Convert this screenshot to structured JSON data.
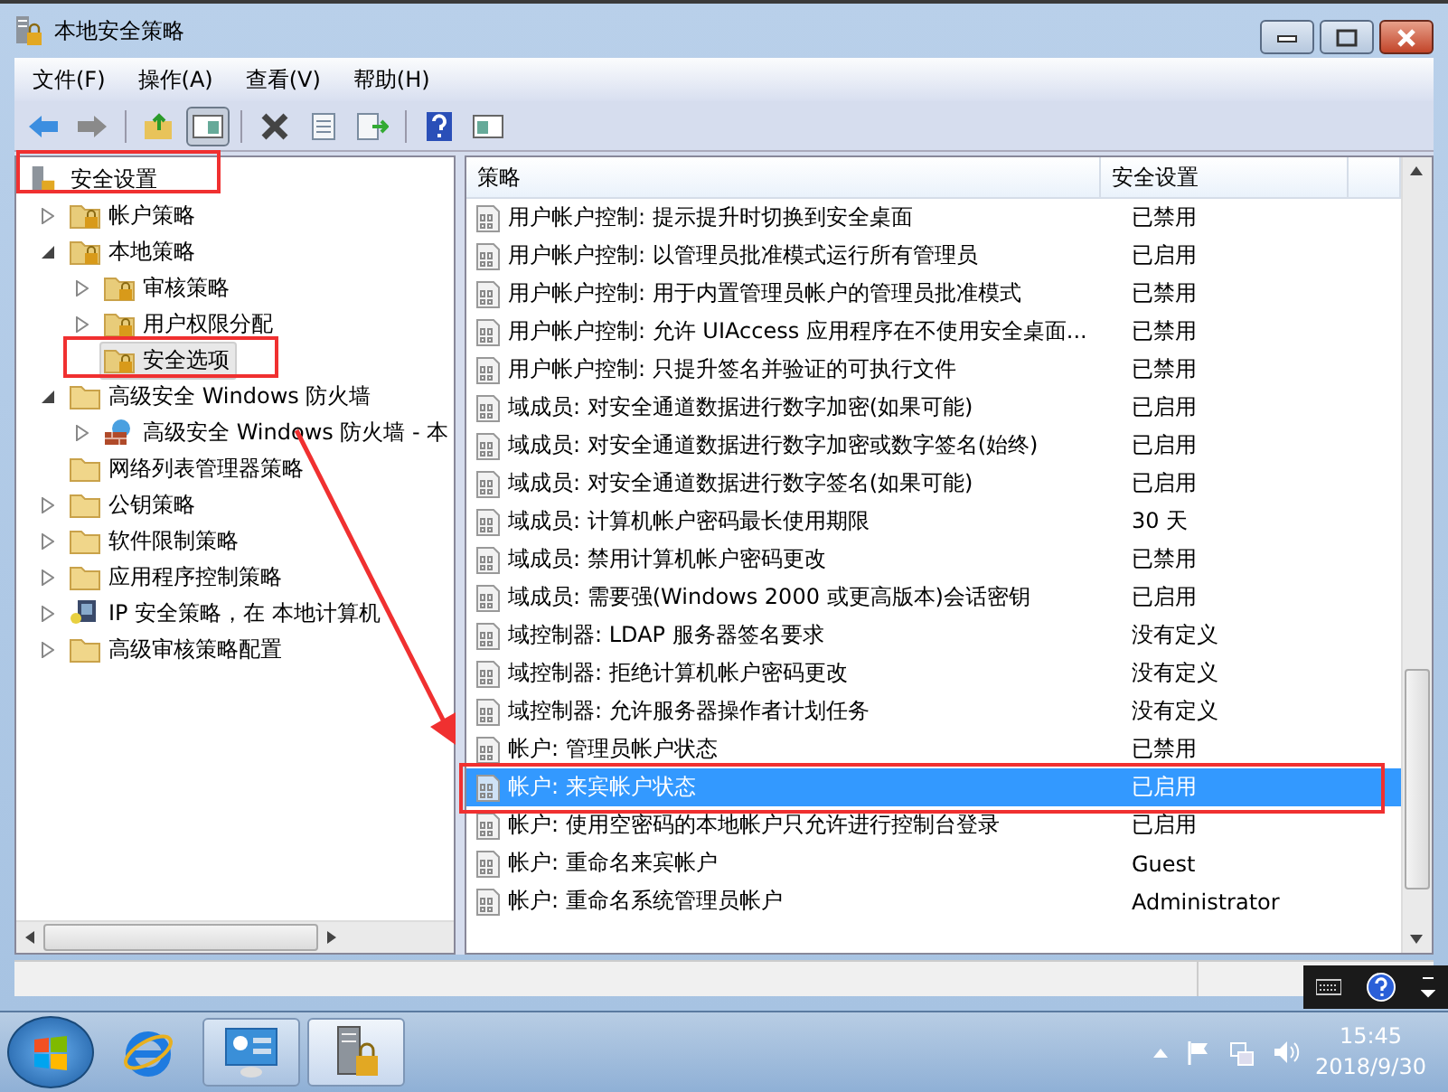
{
  "window": {
    "title": "本地安全策略"
  },
  "menu": [
    "文件(F)",
    "操作(A)",
    "查看(V)",
    "帮助(H)"
  ],
  "tree": {
    "label": "安全设置",
    "selected": false,
    "children": [
      {
        "label": "帐户策略",
        "kind": "lockfolder",
        "expanded": false,
        "selected": false
      },
      {
        "label": "本地策略",
        "kind": "lockfolder",
        "expanded": true,
        "selected": false,
        "children": [
          {
            "label": "审核策略",
            "kind": "lockfolder",
            "expanded": false,
            "selected": false
          },
          {
            "label": "用户权限分配",
            "kind": "lockfolder",
            "expanded": false,
            "selected": false
          },
          {
            "label": "安全选项",
            "kind": "lockfolder",
            "selected": true
          }
        ]
      },
      {
        "label": "高级安全 Windows 防火墙",
        "kind": "folder",
        "expanded": true,
        "selected": false,
        "children": [
          {
            "label": "高级安全 Windows 防火墙 - 本",
            "kind": "firewall",
            "expanded": false,
            "selected": false
          }
        ]
      },
      {
        "label": "网络列表管理器策略",
        "kind": "folder",
        "selected": false
      },
      {
        "label": "公钥策略",
        "kind": "folder",
        "expanded": false,
        "selected": false
      },
      {
        "label": "软件限制策略",
        "kind": "folder",
        "expanded": false,
        "selected": false
      },
      {
        "label": "应用程序控制策略",
        "kind": "folder",
        "expanded": false,
        "selected": false
      },
      {
        "label": "IP 安全策略，在 本地计算机",
        "kind": "ipsec",
        "expanded": false,
        "selected": false
      },
      {
        "label": "高级审核策略配置",
        "kind": "folder",
        "expanded": false,
        "selected": false
      }
    ]
  },
  "table": {
    "columns": [
      "策略",
      "安全设置"
    ],
    "rows": [
      {
        "policy": "用户帐户控制: 提示提升时切换到安全桌面",
        "setting": "已禁用",
        "selected": false
      },
      {
        "policy": "用户帐户控制: 以管理员批准模式运行所有管理员",
        "setting": "已启用",
        "selected": false
      },
      {
        "policy": "用户帐户控制: 用于内置管理员帐户的管理员批准模式",
        "setting": "已禁用",
        "selected": false
      },
      {
        "policy": "用户帐户控制: 允许 UIAccess 应用程序在不使用安全桌面...",
        "setting": "已禁用",
        "selected": false
      },
      {
        "policy": "用户帐户控制: 只提升签名并验证的可执行文件",
        "setting": "已禁用",
        "selected": false
      },
      {
        "policy": "域成员: 对安全通道数据进行数字加密(如果可能)",
        "setting": "已启用",
        "selected": false
      },
      {
        "policy": "域成员: 对安全通道数据进行数字加密或数字签名(始终)",
        "setting": "已启用",
        "selected": false
      },
      {
        "policy": "域成员: 对安全通道数据进行数字签名(如果可能)",
        "setting": "已启用",
        "selected": false
      },
      {
        "policy": "域成员: 计算机帐户密码最长使用期限",
        "setting": "30 天",
        "selected": false
      },
      {
        "policy": "域成员: 禁用计算机帐户密码更改",
        "setting": "已禁用",
        "selected": false
      },
      {
        "policy": "域成员: 需要强(Windows 2000 或更高版本)会话密钥",
        "setting": "已启用",
        "selected": false
      },
      {
        "policy": "域控制器: LDAP 服务器签名要求",
        "setting": "没有定义",
        "selected": false
      },
      {
        "policy": "域控制器: 拒绝计算机帐户密码更改",
        "setting": "没有定义",
        "selected": false
      },
      {
        "policy": "域控制器: 允许服务器操作者计划任务",
        "setting": "没有定义",
        "selected": false
      },
      {
        "policy": "帐户: 管理员帐户状态",
        "setting": "已禁用",
        "selected": false
      },
      {
        "policy": "帐户: 来宾帐户状态",
        "setting": "已启用",
        "selected": true
      },
      {
        "policy": "帐户: 使用空密码的本地帐户只允许进行控制台登录",
        "setting": "已启用",
        "selected": false
      },
      {
        "policy": "帐户: 重命名来宾帐户",
        "setting": "Guest",
        "selected": false
      },
      {
        "policy": "帐户: 重命名系统管理员帐户",
        "setting": "Administrator",
        "selected": false
      }
    ]
  },
  "clock": {
    "time": "15:45",
    "date": "2018/9/30"
  }
}
